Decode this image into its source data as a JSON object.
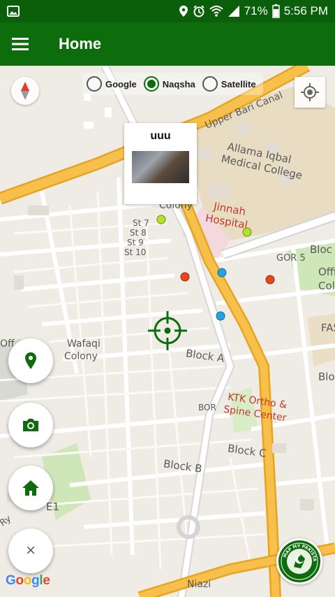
{
  "status_bar": {
    "battery": "71%",
    "time": "5:56 PM",
    "icons": [
      "image-icon",
      "location-icon",
      "alarm-icon",
      "wifi-icon",
      "signal-icon",
      "battery-icon"
    ]
  },
  "app_bar": {
    "title": "Home",
    "menu_icon": "hamburger-menu-icon"
  },
  "map_type": {
    "options": [
      {
        "label": "Google",
        "selected": false
      },
      {
        "label": "Naqsha",
        "selected": true
      },
      {
        "label": "Satellite",
        "selected": false
      }
    ]
  },
  "info_window": {
    "title": "uuu"
  },
  "map_labels": {
    "upper_canal": "Upper Bari Canal",
    "college": "Allama Iqbal",
    "college2": "Medical College",
    "colony": "Colony",
    "jinnah": "Jinnah",
    "hospital": "Hospital",
    "st7": "St 7",
    "st8": "St 8",
    "st9": "St 9",
    "st10": "St 10",
    "gor5": "GOR 5",
    "block_a": "Block A",
    "wafaqi": "Wafaqi",
    "colony2": "Colony",
    "ktk": "KTK Ortho &",
    "spine": "Spine Center",
    "bor": "BOR",
    "block_c": "Block C",
    "block_b": "Block B",
    "e1": "E1",
    "niazi": "Niazi",
    "bloc_top": "Bloc",
    "off": "Off",
    "col": "Col",
    "fas": "FAS",
    "bloc_right": "Bloc",
    "block_c_top": "Block C",
    "offi": "Offi",
    "ry": "Ry"
  },
  "controls": {
    "compass_icon": "compass-icon",
    "locate_icon": "my-location-icon",
    "crosshair_icon": "crosshair-icon",
    "fab_location": "location-pin-icon",
    "fab_camera": "camera-icon",
    "fab_home": "home-icon",
    "fab_close": "close-icon",
    "close_glyph": "×"
  },
  "google_logo": "Google",
  "brand_logo_text": "MAP MY PAKISTAN",
  "colors": {
    "primary": "#0d6d0d",
    "status_bar": "#0b5f0b",
    "road_major": "#f5b731",
    "marker_green": "#b5e02f",
    "marker_blue": "#29a3e0",
    "marker_red": "#e5471e"
  }
}
